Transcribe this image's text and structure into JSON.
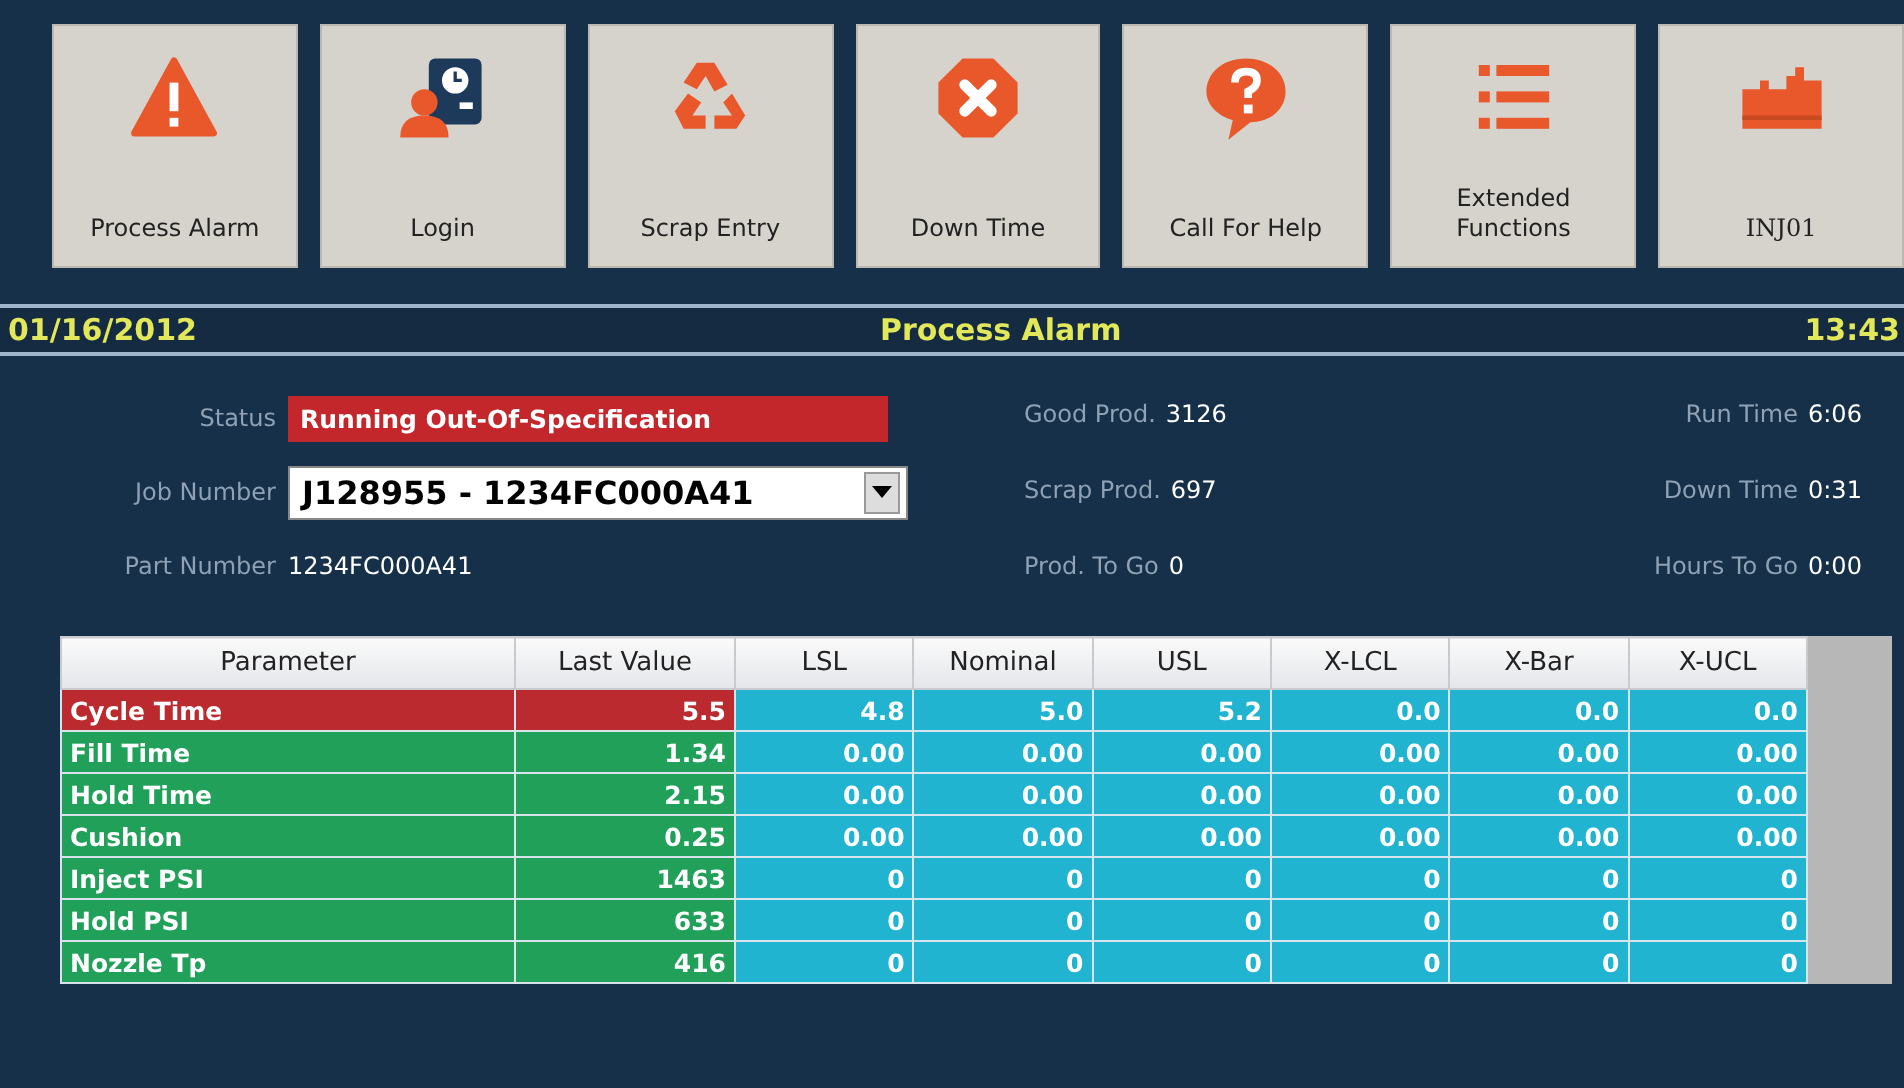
{
  "toolbar": [
    {
      "kind": "alarm",
      "label": "Process Alarm"
    },
    {
      "kind": "login",
      "label": "Login"
    },
    {
      "kind": "scrap",
      "label": "Scrap Entry"
    },
    {
      "kind": "down",
      "label": "Down Time"
    },
    {
      "kind": "help",
      "label": "Call For Help"
    },
    {
      "kind": "functions",
      "label": "Extended Functions"
    },
    {
      "kind": "machine",
      "label": "INJ01"
    }
  ],
  "title_bar": {
    "date": "01/16/2012",
    "title": "Process Alarm",
    "time": "13:43"
  },
  "info": {
    "status_label": "Status",
    "status": "Running Out-Of-Specification",
    "job_label": "Job Number",
    "job": "J128955 - 1234FC000A41",
    "part_label": "Part Number",
    "part": "1234FC000A41",
    "stats": [
      {
        "label": "Good Prod.",
        "value": "3126"
      },
      {
        "label": "Run Time",
        "value": "6:06"
      },
      {
        "label": "Scrap Prod.",
        "value": "697"
      },
      {
        "label": "Down Time",
        "value": "0:31"
      },
      {
        "label": "Prod. To Go",
        "value": "0"
      },
      {
        "label": "Hours To Go",
        "value": "0:00"
      }
    ]
  },
  "table": {
    "columns": [
      "Parameter",
      "Last Value",
      "LSL",
      "Nominal",
      "USL",
      "X-LCL",
      "X-Bar",
      "X-UCL"
    ],
    "rows": [
      {
        "alarm": true,
        "cells": [
          "Cycle Time",
          "5.5",
          "4.8",
          "5.0",
          "5.2",
          "0.0",
          "0.0",
          "0.0"
        ]
      },
      {
        "alarm": false,
        "cells": [
          "Fill Time",
          "1.34",
          "0.00",
          "0.00",
          "0.00",
          "0.00",
          "0.00",
          "0.00"
        ]
      },
      {
        "alarm": false,
        "cells": [
          "Hold Time",
          "2.15",
          "0.00",
          "0.00",
          "0.00",
          "0.00",
          "0.00",
          "0.00"
        ]
      },
      {
        "alarm": false,
        "cells": [
          "Cushion",
          "0.25",
          "0.00",
          "0.00",
          "0.00",
          "0.00",
          "0.00",
          "0.00"
        ]
      },
      {
        "alarm": false,
        "cells": [
          "Inject PSI",
          "1463",
          "0",
          "0",
          "0",
          "0",
          "0",
          "0"
        ]
      },
      {
        "alarm": false,
        "cells": [
          "Hold PSI",
          "633",
          "0",
          "0",
          "0",
          "0",
          "0",
          "0"
        ]
      },
      {
        "alarm": false,
        "cells": [
          "Nozzle Tp",
          "416",
          "0",
          "0",
          "0",
          "0",
          "0",
          "0"
        ]
      }
    ]
  }
}
